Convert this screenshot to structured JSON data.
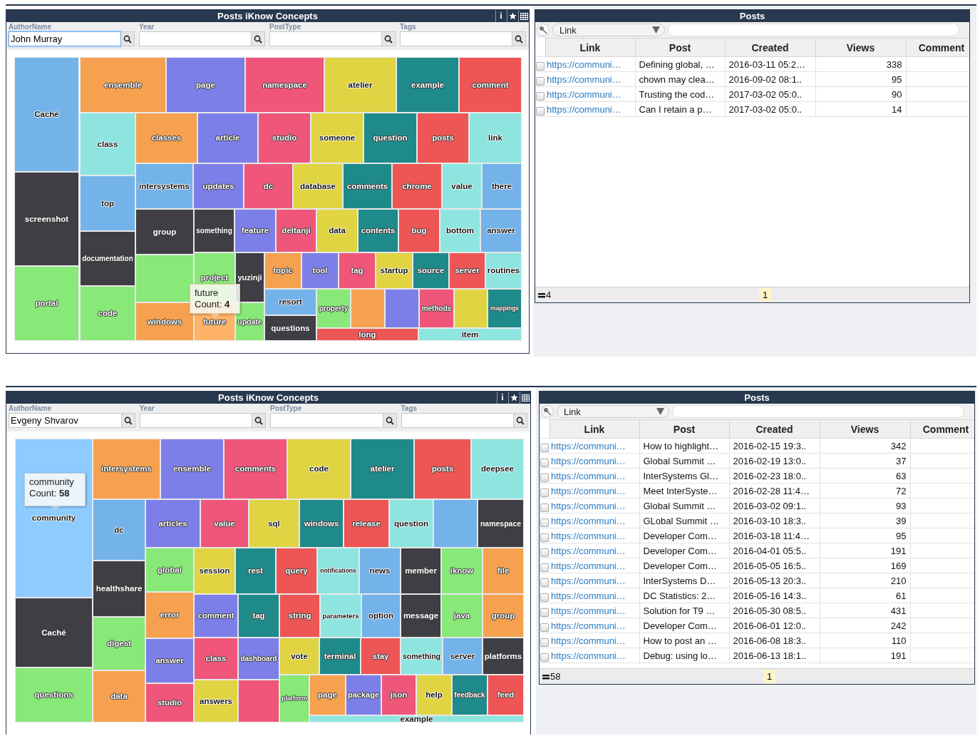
{
  "dashboards": [
    {
      "concepts_panel": {
        "title": "Posts iKnow Concepts",
        "tool_buttons": [
          {
            "kind": "info",
            "glyph": "i"
          },
          {
            "kind": "star"
          },
          {
            "kind": "grid"
          }
        ],
        "filters": [
          {
            "label": "AuthorName",
            "value": "John Murray",
            "focused": true
          },
          {
            "label": "Year",
            "focused": false
          },
          {
            "label": "PostType",
            "focused": false
          },
          {
            "label": "Tags",
            "focused": false
          }
        ],
        "treemap": {
          "tiles": [
            {
              "label": "Caché",
              "color": "#74b3ea"
            },
            {
              "label": "screenshot",
              "color": "#3f3e44"
            },
            {
              "label": "portal",
              "color": "#88e878"
            },
            {
              "label": "ensemble",
              "color": "#f5a150"
            },
            {
              "label": "page",
              "color": "#7d7fe8"
            },
            {
              "label": "namespace",
              "color": "#ef567a"
            },
            {
              "label": "atelier",
              "color": "#e0d443"
            },
            {
              "label": "example",
              "color": "#1f8a8a"
            },
            {
              "label": "comment",
              "color": "#ee5555"
            },
            {
              "label": "class",
              "color": "#8ee5e0"
            },
            {
              "label": "top",
              "color": "#74b3ea"
            },
            {
              "label": "documentation",
              "color": "#3f3e44"
            },
            {
              "label": "code",
              "color": "#88e878"
            },
            {
              "label": "classes",
              "color": "#f5a150"
            },
            {
              "label": "article",
              "color": "#7d7fe8"
            },
            {
              "label": "studio",
              "color": "#ef567a"
            },
            {
              "label": "someone",
              "color": "#e0d443"
            },
            {
              "label": "question",
              "color": "#1f8a8a"
            },
            {
              "label": "posts",
              "color": "#ee5555"
            },
            {
              "label": "link",
              "color": "#8ee5e0"
            },
            {
              "label": "intersystems",
              "color": "#74b3ea"
            },
            {
              "label": "updates",
              "color": "#7d7fe8"
            },
            {
              "label": "dc",
              "color": "#ef567a"
            },
            {
              "label": "database",
              "color": "#e0d443"
            },
            {
              "label": "comments",
              "color": "#1f8a8a"
            },
            {
              "label": "chrome",
              "color": "#ee5555"
            },
            {
              "label": "value",
              "color": "#8ee5e0"
            },
            {
              "label": "there",
              "color": "#74b3ea"
            },
            {
              "label": "group",
              "color": "#3f3e44"
            },
            {
              "color": "#88e878"
            },
            {
              "label": "windows",
              "color": "#f5a150"
            },
            {
              "label": "something",
              "color": "#3f3e44"
            },
            {
              "label": "feature",
              "color": "#7d7fe8"
            },
            {
              "label": "deltanji",
              "color": "#ef567a"
            },
            {
              "label": "data",
              "color": "#e0d443"
            },
            {
              "label": "contents",
              "color": "#1f8a8a"
            },
            {
              "label": "bug",
              "color": "#ee5555"
            },
            {
              "label": "bottom",
              "color": "#8ee5e0"
            },
            {
              "label": "answer",
              "color": "#74b3ea"
            },
            {
              "label": "project",
              "color": "#88e878"
            },
            {
              "label": "yuzinji",
              "color": "#3f3e44"
            },
            {
              "label": "future",
              "color": "#ffb366"
            },
            {
              "label": "update",
              "color": "#88e878"
            },
            {
              "label": "topic",
              "color": "#f5a150"
            },
            {
              "label": "tool",
              "color": "#7d7fe8"
            },
            {
              "label": "tag",
              "color": "#ef567a"
            },
            {
              "label": "startup",
              "color": "#e0d443"
            },
            {
              "label": "source",
              "color": "#1f8a8a"
            },
            {
              "label": "server",
              "color": "#ee5555"
            },
            {
              "label": "routines",
              "color": "#8ee5e0"
            },
            {
              "label": "resort",
              "color": "#74b3ea"
            },
            {
              "label": "questions",
              "color": "#3f3e44"
            },
            {
              "label": "property",
              "color": "#88e878"
            },
            {
              "color": "#f5a150"
            },
            {
              "color": "#7d7fe8"
            },
            {
              "label": "methods",
              "color": "#ef567a"
            },
            {
              "color": "#e0d443"
            },
            {
              "label": "mappings",
              "color": "#1f8a8a"
            },
            {
              "label": "long",
              "color": "#ee5555"
            },
            {
              "label": "item",
              "color": "#8ee5e0"
            }
          ],
          "tooltip": {
            "title": "future",
            "count": "Count: **4**"
          }
        }
      },
      "posts_panel": {
        "title": "Posts",
        "search_field": "Link",
        "columns": [
          "Link",
          "Post",
          "Created",
          "Views",
          "Comment"
        ],
        "rows": [
          {
            "checked": false,
            "link": "https://communi…",
            "post": "Defining global, …",
            "created": "2016-03-11 05:2…",
            "views": "338"
          },
          {
            "checked": false,
            "link": "https://communi…",
            "post": "chown may clea…",
            "created": "2016-09-02 08:1..",
            "views": "95"
          },
          {
            "checked": false,
            "link": "https://communi…",
            "post": "Trusting the cod…",
            "created": "2017-03-02 05:0..",
            "views": "90"
          },
          {
            "checked": false,
            "link": "https://communi…",
            "post": "Can I retain a p…",
            "created": "2017-03-02 05:0..",
            "views": "14"
          }
        ],
        "footer": {
          "total": "4",
          "page": "1"
        }
      }
    },
    {
      "concepts_panel": {
        "title": "Posts iKnow Concepts",
        "tool_buttons": [
          {
            "kind": "info",
            "glyph": "i"
          },
          {
            "kind": "star"
          },
          {
            "kind": "grid"
          }
        ],
        "filters": [
          {
            "label": "AuthorName",
            "value": "Evgeny Shvarov",
            "focused": false
          },
          {
            "label": "Year",
            "focused": false
          },
          {
            "label": "PostType",
            "focused": false
          },
          {
            "label": "Tags",
            "focused": false
          }
        ],
        "treemap": {
          "tiles": [
            {
              "label": "community",
              "color": "#8ecbff"
            },
            {
              "label": "Caché",
              "color": "#3f3e44"
            },
            {
              "label": "questions",
              "color": "#88e878"
            },
            {
              "label": "intersystems",
              "color": "#f5a150"
            },
            {
              "label": "ensemble",
              "color": "#7d7fe8"
            },
            {
              "label": "comments",
              "color": "#ef567a"
            },
            {
              "label": "code",
              "color": "#e0d443"
            },
            {
              "label": "atelier",
              "color": "#1f8a8a"
            },
            {
              "label": "posts",
              "color": "#ee5555"
            },
            {
              "label": "deepsee",
              "color": "#8ee5e0"
            },
            {
              "label": "dc",
              "color": "#74b3ea"
            },
            {
              "label": "healthshare",
              "color": "#3f3e44"
            },
            {
              "label": "digest",
              "color": "#88e878"
            },
            {
              "label": "data",
              "color": "#f5a150"
            },
            {
              "label": "articles",
              "color": "#7d7fe8"
            },
            {
              "label": "value",
              "color": "#ef567a"
            },
            {
              "label": "sql",
              "color": "#e0d443"
            },
            {
              "label": "windows",
              "color": "#1f8a8a"
            },
            {
              "label": "release",
              "color": "#ee5555"
            },
            {
              "label": "question",
              "color": "#8ee5e0"
            },
            {
              "color": "#74b3ea"
            },
            {
              "label": "namespace",
              "color": "#3f3e44"
            },
            {
              "label": "global",
              "color": "#88e878"
            },
            {
              "label": "error",
              "color": "#f5a150"
            },
            {
              "label": "answer",
              "color": "#7d7fe8"
            },
            {
              "label": "studio",
              "color": "#ef567a"
            },
            {
              "label": "session",
              "color": "#e0d443"
            },
            {
              "label": "rest",
              "color": "#1f8a8a"
            },
            {
              "label": "query",
              "color": "#ee5555"
            },
            {
              "label": "notifications",
              "color": "#8ee5e0"
            },
            {
              "label": "news",
              "color": "#74b3ea"
            },
            {
              "label": "member",
              "color": "#3f3e44"
            },
            {
              "label": "iknow",
              "color": "#88e878"
            },
            {
              "label": "file",
              "color": "#f5a150"
            },
            {
              "label": "comment",
              "color": "#7d7fe8"
            },
            {
              "label": "tag",
              "color": "#1f8a8a"
            },
            {
              "label": "string",
              "color": "#ee5555"
            },
            {
              "label": "parameters",
              "color": "#8ee5e0"
            },
            {
              "label": "option",
              "color": "#74b3ea"
            },
            {
              "label": "message",
              "color": "#3f3e44"
            },
            {
              "label": "java",
              "color": "#88e878"
            },
            {
              "label": "group",
              "color": "#f5a150"
            },
            {
              "label": "class",
              "color": "#ef567a"
            },
            {
              "label": "answers",
              "color": "#e0d443"
            },
            {
              "label": "dashboard",
              "color": "#7d7fe8"
            },
            {
              "color": "#ef567a"
            },
            {
              "label": "vote",
              "color": "#e0d443"
            },
            {
              "label": "terminal",
              "color": "#1f8a8a"
            },
            {
              "label": "stay",
              "color": "#ee5555"
            },
            {
              "label": "something",
              "color": "#8ee5e0"
            },
            {
              "label": "server",
              "color": "#74b3ea"
            },
            {
              "label": "platforms",
              "color": "#3f3e44"
            },
            {
              "label": "platform",
              "color": "#88e878"
            },
            {
              "label": "page",
              "color": "#f5a150"
            },
            {
              "label": "package",
              "color": "#7d7fe8"
            },
            {
              "label": "json",
              "color": "#ef567a"
            },
            {
              "label": "help",
              "color": "#e0d443"
            },
            {
              "label": "feedback",
              "color": "#1f8a8a"
            },
            {
              "label": "feed",
              "color": "#ee5555"
            },
            {
              "label": "example",
              "color": "#8ee5e0"
            }
          ],
          "tooltip": {
            "title": "community",
            "count": "Count: **58**"
          }
        }
      },
      "posts_panel": {
        "title": "Posts",
        "search_field": "Link",
        "columns": [
          "Link",
          "Post",
          "Created",
          "Views",
          "Comment"
        ],
        "rows": [
          {
            "checked": false,
            "link": "https://communi…",
            "post": "How to highlight…",
            "created": "2016-02-15 19:3..",
            "views": "342"
          },
          {
            "checked": false,
            "link": "https://communi…",
            "post": "Global Summit …",
            "created": "2016-02-19 13:0..",
            "views": "37"
          },
          {
            "checked": false,
            "link": "https://communi…",
            "post": "InterSystems Gl…",
            "created": "2016-02-23 18:0..",
            "views": "63"
          },
          {
            "checked": false,
            "link": "https://communi…",
            "post": "Meet InterSyste…",
            "created": "2016-02-28 11:4…",
            "views": "72"
          },
          {
            "checked": false,
            "link": "https://communi…",
            "post": "Global Summit …",
            "created": "2016-03-02 09:1..",
            "views": "93"
          },
          {
            "checked": false,
            "link": "https://communi…",
            "post": "GLobal Summit …",
            "created": "2016-03-10 18:3..",
            "views": "39"
          },
          {
            "checked": false,
            "link": "https://communi…",
            "post": "Developer Com…",
            "created": "2016-03-18 11:4…",
            "views": "95"
          },
          {
            "checked": false,
            "link": "https://communi…",
            "post": "Developer Com…",
            "created": "2016-04-01 05:5..",
            "views": "191"
          },
          {
            "checked": false,
            "link": "https://communi…",
            "post": "Developer Com…",
            "created": "2016-05-05 16:5..",
            "views": "169"
          },
          {
            "checked": false,
            "link": "https://communi…",
            "post": "InterSystems D…",
            "created": "2016-05-13 20:3..",
            "views": "210"
          },
          {
            "checked": false,
            "link": "https://communi…",
            "post": "DC Statistics: 2…",
            "created": "2016-05-16 14:3..",
            "views": "61"
          },
          {
            "checked": false,
            "link": "https://communi…",
            "post": "Solution for T9 …",
            "created": "2016-05-30 08:5..",
            "views": "431"
          },
          {
            "checked": false,
            "link": "https://communi…",
            "post": "Developer Com…",
            "created": "2016-06-01 12:0..",
            "views": "242"
          },
          {
            "checked": false,
            "link": "https://communi…",
            "post": "How to post an …",
            "created": "2016-06-08 18:3..",
            "views": "110"
          },
          {
            "checked": false,
            "link": "https://communi…",
            "post": "Debug: using lo…",
            "created": "2016-06-13 18:1..",
            "views": "191"
          }
        ],
        "footer": {
          "total": "58",
          "page": "1"
        }
      }
    }
  ]
}
